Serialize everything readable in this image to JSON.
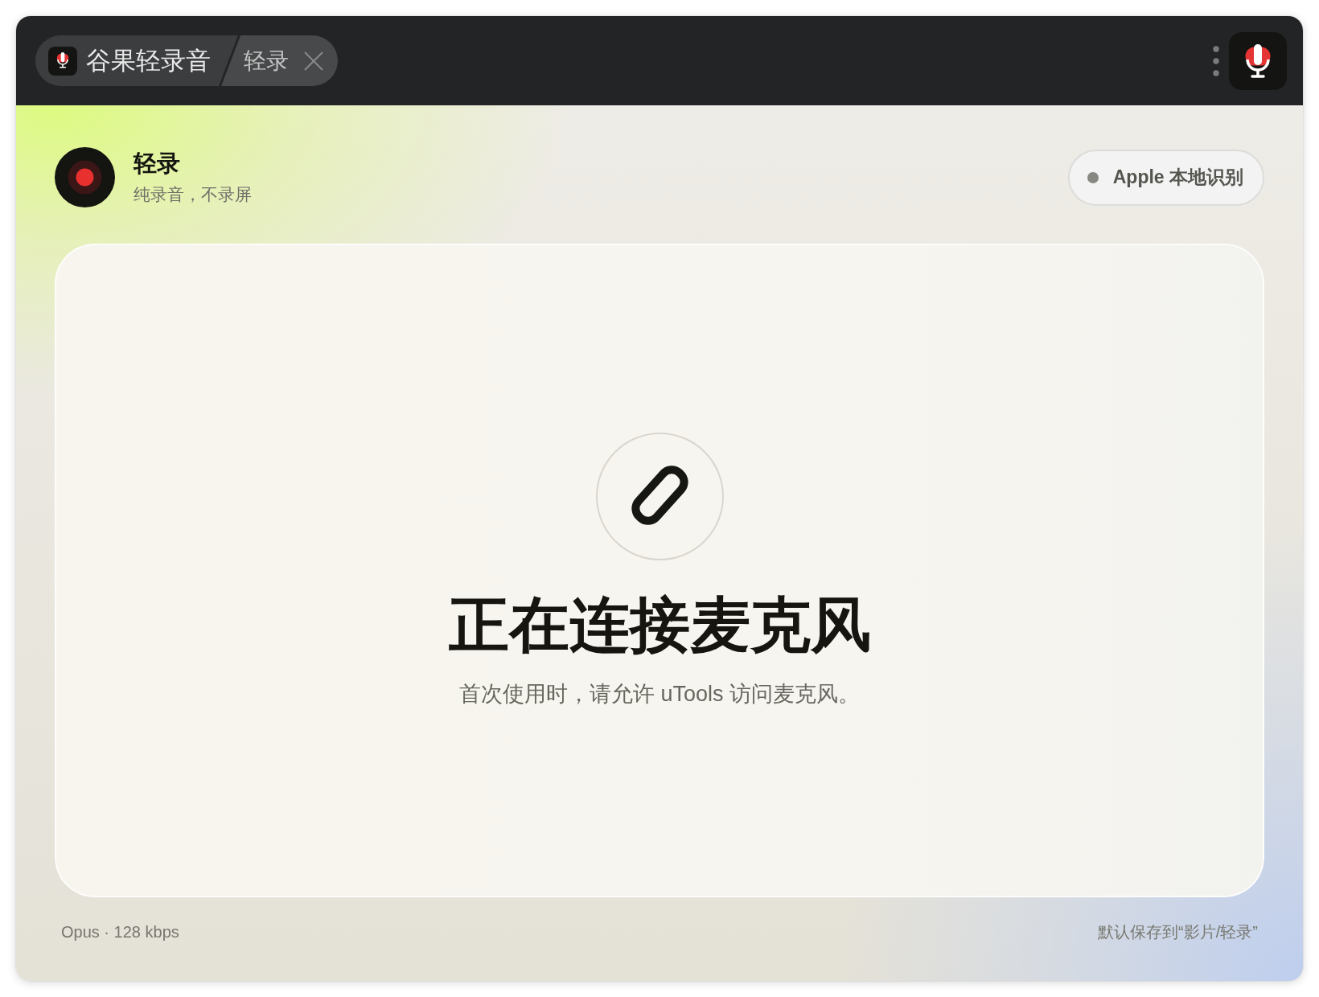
{
  "title_bar": {
    "app_name": "谷果轻录音",
    "feature_tab": "轻录"
  },
  "header": {
    "title": "轻录",
    "subtitle": "纯录音，不录屏",
    "engine": "Apple 本地识别"
  },
  "status_card": {
    "title": "正在连接麦克风",
    "message": "首次使用时，请允许 uTools 访问麦克风。"
  },
  "footer": {
    "format": "Opus · 128 kbps",
    "save_location": "默认保存到“影片/轻录”"
  }
}
